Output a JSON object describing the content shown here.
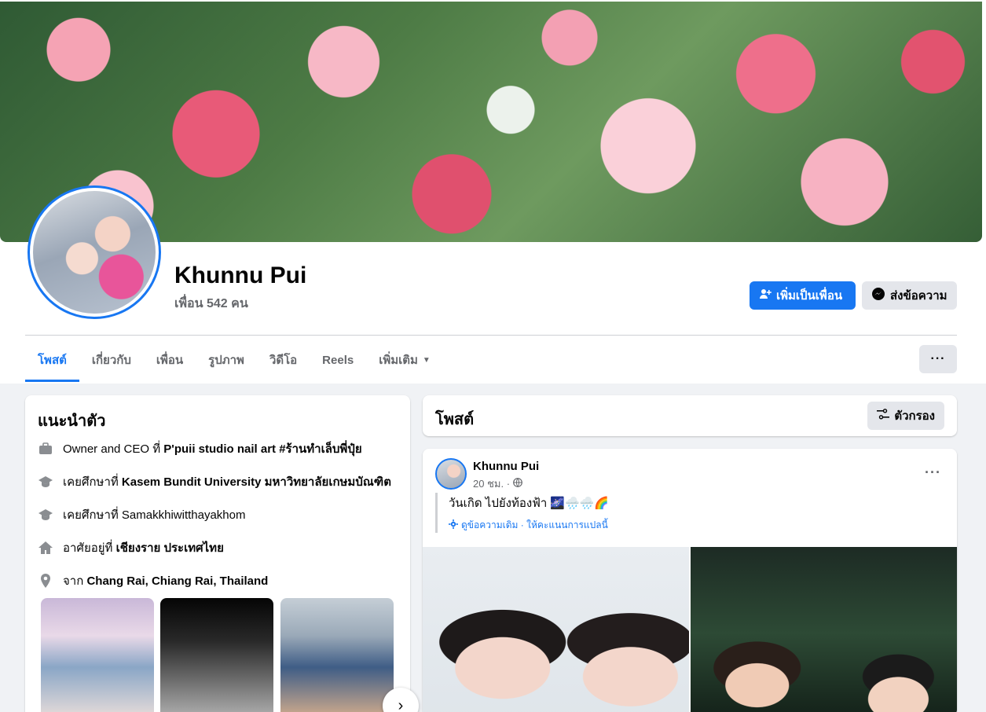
{
  "profile": {
    "name": "Khunnu Pui",
    "friends": "เพื่อน 542 คน"
  },
  "actions": {
    "add_friend": "เพิ่มเป็นเพื่อน",
    "message": "ส่งข้อความ"
  },
  "tabs": [
    {
      "label": "โพสต์",
      "active": true
    },
    {
      "label": "เกี่ยวกับ"
    },
    {
      "label": "เพื่อน"
    },
    {
      "label": "รูปภาพ"
    },
    {
      "label": "วิดีโอ"
    },
    {
      "label": "Reels"
    },
    {
      "label": "เพิ่มเติม"
    }
  ],
  "intro": {
    "title": "แนะนำตัว",
    "items": [
      {
        "prefix": "Owner and CEO ที่ ",
        "bold": "P'puii studio nail art #ร้านทำเล็บพี่ปุ๋ย",
        "icon": "briefcase-icon"
      },
      {
        "prefix": "เคยศึกษาที่ ",
        "bold": "Kasem Bundit University มหาวิทยาลัยเกษมบัณฑิต",
        "icon": "graduation-cap-icon"
      },
      {
        "prefix": "เคยศึกษาที่ Samakkhiwitthayakhom",
        "bold": "",
        "icon": "graduation-cap-icon"
      },
      {
        "prefix": "อาศัยอยู่ที่ ",
        "bold": "เชียงราย ประเทศไทย",
        "icon": "home-icon"
      },
      {
        "prefix": "จาก ",
        "bold": "Chang Rai, Chiang Rai, Thailand",
        "icon": "location-pin-icon"
      }
    ]
  },
  "posts": {
    "title": "โพสต์",
    "filter": "ตัวกรอง"
  },
  "post": {
    "author": "Khunnu Pui",
    "time": "20 ชม. ·",
    "text": "วันเกิด ไปยังท้องฟ้า 🌌🌧️🌧️🌈",
    "translate": "ดูข้อความเดิม · ให้คะแนนการแปลนี้"
  },
  "colors": {
    "accent": "#1877f2",
    "background": "#f0f2f5",
    "secondary_text": "#65676b"
  }
}
